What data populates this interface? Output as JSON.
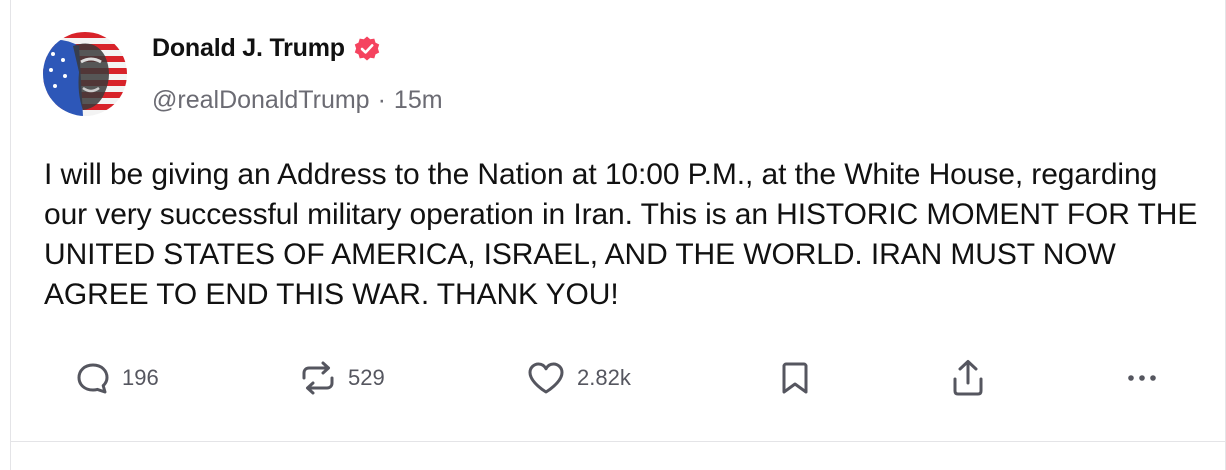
{
  "post": {
    "author": {
      "display_name": "Donald J. Trump",
      "verified_icon": "verified-badge-icon",
      "verified_color": "#f5435f",
      "handle": "@realDonaldTrump",
      "separator": "·",
      "time_ago": "15m"
    },
    "body": "I will be giving an Address to the Nation at 10:00 P.M., at the White House, regarding our very successful military operation in Iran. This is an HISTORIC MOMENT FOR THE UNITED STATES OF AMERICA, ISRAEL, AND THE WORLD. IRAN MUST NOW AGREE TO END THIS WAR. THANK YOU!",
    "actions": {
      "reply": {
        "icon": "comment-icon",
        "count": "196"
      },
      "repost": {
        "icon": "repost-icon",
        "count": "529"
      },
      "like": {
        "icon": "heart-icon",
        "count": "2.82k"
      },
      "bookmark": {
        "icon": "bookmark-icon"
      },
      "share": {
        "icon": "share-icon"
      },
      "more": {
        "icon": "more-icon"
      }
    }
  }
}
